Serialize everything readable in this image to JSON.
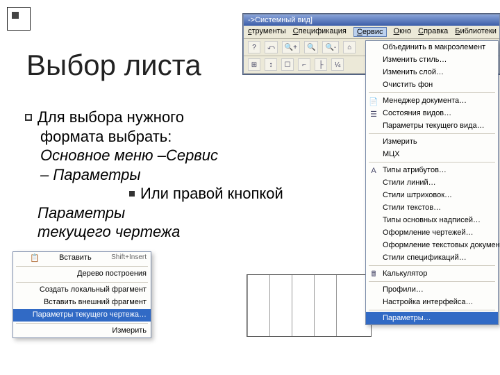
{
  "slide": {
    "title": "Выбор листа",
    "para1a": "Для выбора нужного",
    "para1b": "формата выбрать:",
    "para2a": "Основное меню –Сервис",
    "para2b": "– Параметры",
    "sub1": "Или правой кнопкой",
    "sub2": "Параметры",
    "sub3": "текущего чертежа"
  },
  "app": {
    "title": "->Системный вид]",
    "menubar": [
      "струменты",
      "Спецификация",
      "Сервис",
      "Окно",
      "Справка",
      "Библиотеки"
    ],
    "active_menu_index": 2,
    "toolbar_icons": [
      "?",
      "⤺",
      "🔍+",
      "🔍",
      "🔍-",
      "⌂"
    ],
    "toolbar_icons2": [
      "⊞",
      "↕",
      "☐",
      "⌐",
      "├",
      "¼"
    ]
  },
  "service_menu": {
    "items": [
      {
        "label": "Объединить в макроэлемент",
        "icon": ""
      },
      {
        "label": "Изменить стиль…",
        "icon": ""
      },
      {
        "label": "Изменить слой…",
        "icon": ""
      },
      {
        "label": "Очистить фон",
        "icon": ""
      },
      {
        "sep": true
      },
      {
        "label": "Менеджер документа…",
        "icon": "📄"
      },
      {
        "label": "Состояния видов…",
        "icon": "☰"
      },
      {
        "label": "Параметры текущего вида…",
        "icon": ""
      },
      {
        "sep": true
      },
      {
        "label": "Измерить",
        "icon": ""
      },
      {
        "label": "МЦХ",
        "icon": ""
      },
      {
        "sep": true
      },
      {
        "label": "Типы атрибутов…",
        "icon": "А"
      },
      {
        "label": "Стили линий…",
        "icon": ""
      },
      {
        "label": "Стили штриховок…",
        "icon": ""
      },
      {
        "label": "Стили текстов…",
        "icon": ""
      },
      {
        "label": "Типы основных надписей…",
        "icon": ""
      },
      {
        "label": "Оформление чертежей…",
        "icon": ""
      },
      {
        "label": "Оформление текстовых документов…",
        "icon": ""
      },
      {
        "label": "Стили спецификаций…",
        "icon": ""
      },
      {
        "sep": true
      },
      {
        "label": "Калькулятор",
        "icon": "🖩"
      },
      {
        "sep": true
      },
      {
        "label": "Профили…",
        "icon": ""
      },
      {
        "label": "Настройка интерфейса…",
        "icon": ""
      },
      {
        "sep": true
      },
      {
        "label": "Параметры…",
        "icon": "",
        "highlight": true
      }
    ]
  },
  "ctx_menu": {
    "items": [
      {
        "label": "Вставить",
        "shortcut": "Shift+Insert",
        "icon": "📋"
      },
      {
        "sep": true
      },
      {
        "label": "Дерево построения",
        "icon": ""
      },
      {
        "sep": true
      },
      {
        "label": "Создать локальный фрагмент",
        "icon": ""
      },
      {
        "label": "Вставить внешний фрагмент",
        "icon": ""
      },
      {
        "label": "Параметры текущего чертежа…",
        "highlight": true
      },
      {
        "sep": true
      },
      {
        "label": "Измерить",
        "icon": ""
      }
    ]
  }
}
